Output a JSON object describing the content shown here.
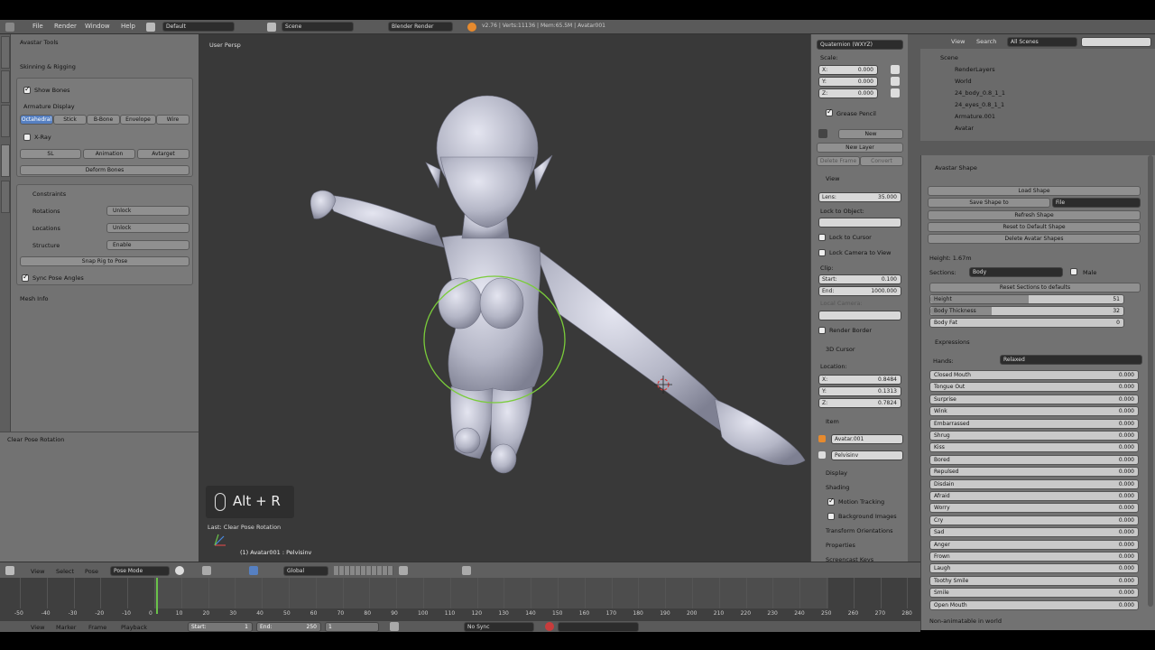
{
  "top_menu": {
    "items": [
      "File",
      "Render",
      "Window",
      "Help"
    ],
    "layout": "Default",
    "scene": "Scene",
    "engine": "Blender Render",
    "stats": "v2.76 | Verts:11136 | Mem:65.5M | Avatar001"
  },
  "left_panel": {
    "tabs": [
      "Tools",
      "Options",
      "Grease Pencil",
      "Avatar",
      "Animation"
    ],
    "avastar_tools": "Avastar Tools",
    "skinning_header": "Skinning & Rigging",
    "show_bones": "Show Bones",
    "armature_display": "Armature Display",
    "display_modes": [
      "Octahedral",
      "Stick",
      "B-Bone",
      "Envelope",
      "Wire"
    ],
    "xray": "X-Ray",
    "bone_groups": [
      "SL",
      "Animation",
      "Avtarget"
    ],
    "deform_bones": "Deform Bones",
    "constraints": "Constraints",
    "rotations_label": "Rotations",
    "rotations_value": "Unlock",
    "locations_label": "Locations",
    "locations_value": "Unlock",
    "structure_label": "Structure",
    "structure_value": "Enable",
    "snap_rig": "Snap Rig to Pose",
    "sync_pose": "Sync Pose Angles",
    "mesh_info": "Mesh Info",
    "operator": "Clear Pose Rotation"
  },
  "viewport": {
    "label": "User Persp",
    "shortcut": "Alt + R",
    "last_op": "Last: Clear Pose Rotation",
    "object_info": "(1) Avatar001 : Pelvisinv"
  },
  "n_panel": {
    "rotation_mode": "Quaternion (WXYZ)",
    "scale_label": "Scale:",
    "scale": [
      {
        "axis": "X:",
        "value": "0.000"
      },
      {
        "axis": "Y:",
        "value": "0.000"
      },
      {
        "axis": "Z:",
        "value": "0.000"
      }
    ],
    "grease_pencil": "Grease Pencil",
    "new": "New",
    "new_layer": "New Layer",
    "delete_frame": "Delete Frame",
    "convert": "Convert",
    "view_header": "View",
    "lens": "Lens:",
    "lens_value": "35.000",
    "lock_to_object": "Lock to Object:",
    "lock_to_cursor": "Lock to Cursor",
    "lock_camera": "Lock Camera to View",
    "clip": "Clip:",
    "clip_start": "Start:",
    "clip_start_value": "0.100",
    "clip_end": "End:",
    "clip_end_value": "1000.000",
    "local_camera": "Local Camera:",
    "render_border": "Render Border",
    "cursor_header": "3D Cursor",
    "location_label": "Location:",
    "cursor": [
      {
        "axis": "X:",
        "value": "0.8484"
      },
      {
        "axis": "Y:",
        "value": "0.1313"
      },
      {
        "axis": "Z:",
        "value": "0.7824"
      }
    ],
    "item_header": "Item",
    "item_object": "Avatar.001",
    "item_bone": "Pelvisinv",
    "display": "Display",
    "shading": "Shading",
    "motion_tracking": "Motion Tracking",
    "background_images": "Background Images",
    "transform_orientations": "Transform Orientations",
    "properties": "Properties",
    "screencast_keys": "Screencast Keys"
  },
  "outliner": {
    "menu": [
      "View",
      "Search"
    ],
    "filter": "All Scenes",
    "rows": [
      "Scene",
      "RenderLayers",
      "World",
      "24_body_0.8_1_1",
      "24_eyes_0.8_1_1",
      "Armature.001",
      "Avatar"
    ]
  },
  "properties": {
    "avatar_shape_header": "Avastar Shape",
    "load_shape": "Load Shape",
    "save_shape_to": "Save Shape to",
    "save_target": "File",
    "refresh_shape": "Refresh Shape",
    "reset_default": "Reset to Default Shape",
    "delete_shapes": "Delete Avatar Shapes",
    "height_label": "Height: 1.67m",
    "sections_label": "Sections:",
    "sections_value": "Body",
    "male": "Male",
    "reset_sections": "Reset Sections to defaults",
    "body_sliders": [
      {
        "label": "Height",
        "value": "51",
        "fill": 0.51
      },
      {
        "label": "Body Thickness",
        "value": "32",
        "fill": 0.32
      },
      {
        "label": "Body Fat",
        "value": "0",
        "fill": 0.0
      }
    ],
    "expressions_header": "Expressions",
    "hands_label": "Hands:",
    "hands_value": "Relaxed",
    "expressions": [
      {
        "label": "Closed Mouth",
        "value": "0.000"
      },
      {
        "label": "Tongue Out",
        "value": "0.000"
      },
      {
        "label": "Surprise",
        "value": "0.000"
      },
      {
        "label": "Wink",
        "value": "0.000"
      },
      {
        "label": "Embarrassed",
        "value": "0.000"
      },
      {
        "label": "Shrug",
        "value": "0.000"
      },
      {
        "label": "Kiss",
        "value": "0.000"
      },
      {
        "label": "Bored",
        "value": "0.000"
      },
      {
        "label": "Repulsed",
        "value": "0.000"
      },
      {
        "label": "Disdain",
        "value": "0.000"
      },
      {
        "label": "Afraid",
        "value": "0.000"
      },
      {
        "label": "Worry",
        "value": "0.000"
      },
      {
        "label": "Cry",
        "value": "0.000"
      },
      {
        "label": "Sad",
        "value": "0.000"
      },
      {
        "label": "Anger",
        "value": "0.000"
      },
      {
        "label": "Frown",
        "value": "0.000"
      },
      {
        "label": "Laugh",
        "value": "0.000"
      },
      {
        "label": "Toothy Smile",
        "value": "0.000"
      },
      {
        "label": "Smile",
        "value": "0.000"
      },
      {
        "label": "Open Mouth",
        "value": "0.000"
      }
    ],
    "footer_note": "Non-animatable in world"
  },
  "viewport_header": {
    "menus": [
      "View",
      "Select",
      "Pose"
    ],
    "mode": "Pose Mode",
    "orientation": "Global"
  },
  "timeline": {
    "ticks": [
      "-50",
      "-40",
      "-30",
      "-20",
      "-10",
      "0",
      "10",
      "20",
      "30",
      "40",
      "50",
      "60",
      "70",
      "80",
      "90",
      "100",
      "110",
      "120",
      "130",
      "140",
      "150",
      "160",
      "170",
      "180",
      "190",
      "200",
      "210",
      "220",
      "230",
      "240",
      "250",
      "260",
      "270",
      "280"
    ],
    "menus": [
      "View",
      "Marker",
      "Frame",
      "Playback"
    ],
    "start_label": "Start:",
    "start_value": "1",
    "end_label": "End:",
    "end_value": "250",
    "current": "1",
    "sync": "No Sync"
  }
}
